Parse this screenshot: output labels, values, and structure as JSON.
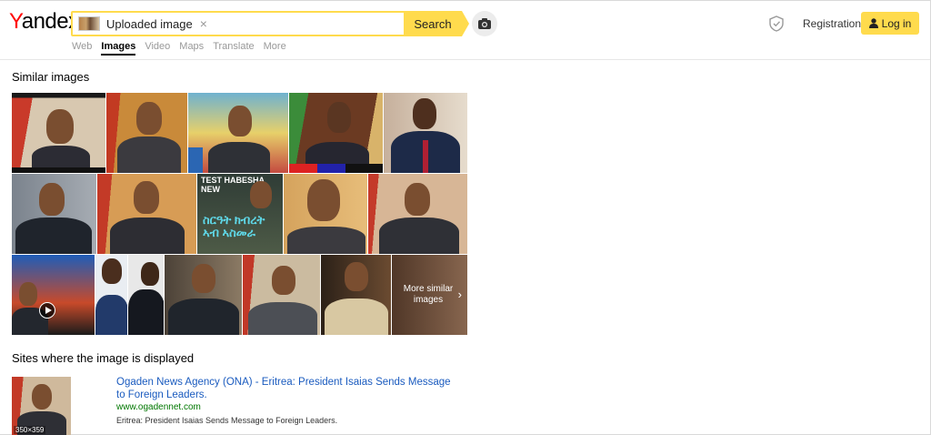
{
  "header": {
    "logo_first": "Y",
    "logo_rest": "andex",
    "search": {
      "chip_label": "Uploaded image",
      "close_symbol": "×",
      "button_label": "Search"
    },
    "nav": [
      "Web",
      "Images",
      "Video",
      "Maps",
      "Translate",
      "More"
    ],
    "nav_active": "Images",
    "registration_label": "Registration",
    "login_label": "Log in"
  },
  "similar": {
    "title": "Similar images",
    "overlay_texts": {
      "test_habesha": "TEST HABESHA NEW",
      "ad_text": "ስርዓት ክብረት\nኣብ ኣስመራ",
      "more_label": "More similar images",
      "more_chevron": "›"
    }
  },
  "sites": {
    "title": "Sites where the image is displayed",
    "results": [
      {
        "title": "Ogaden News Agency (ONA) - Eritrea: President Isaias Sends Message to Foreign Leaders.",
        "url": "www.ogadennet.com",
        "description": "Eritrea: President Isaias Sends Message to Foreign Leaders.",
        "size": "350×359"
      }
    ]
  },
  "colors": {
    "accent_yellow": "#ffdb4d",
    "link_blue": "#1a5bbf",
    "url_green": "#007700",
    "logo_red": "#ff0000"
  },
  "icons": [
    "camera-icon",
    "shield-icon",
    "user-icon",
    "play-icon",
    "close-icon",
    "chevron-right-icon"
  ]
}
